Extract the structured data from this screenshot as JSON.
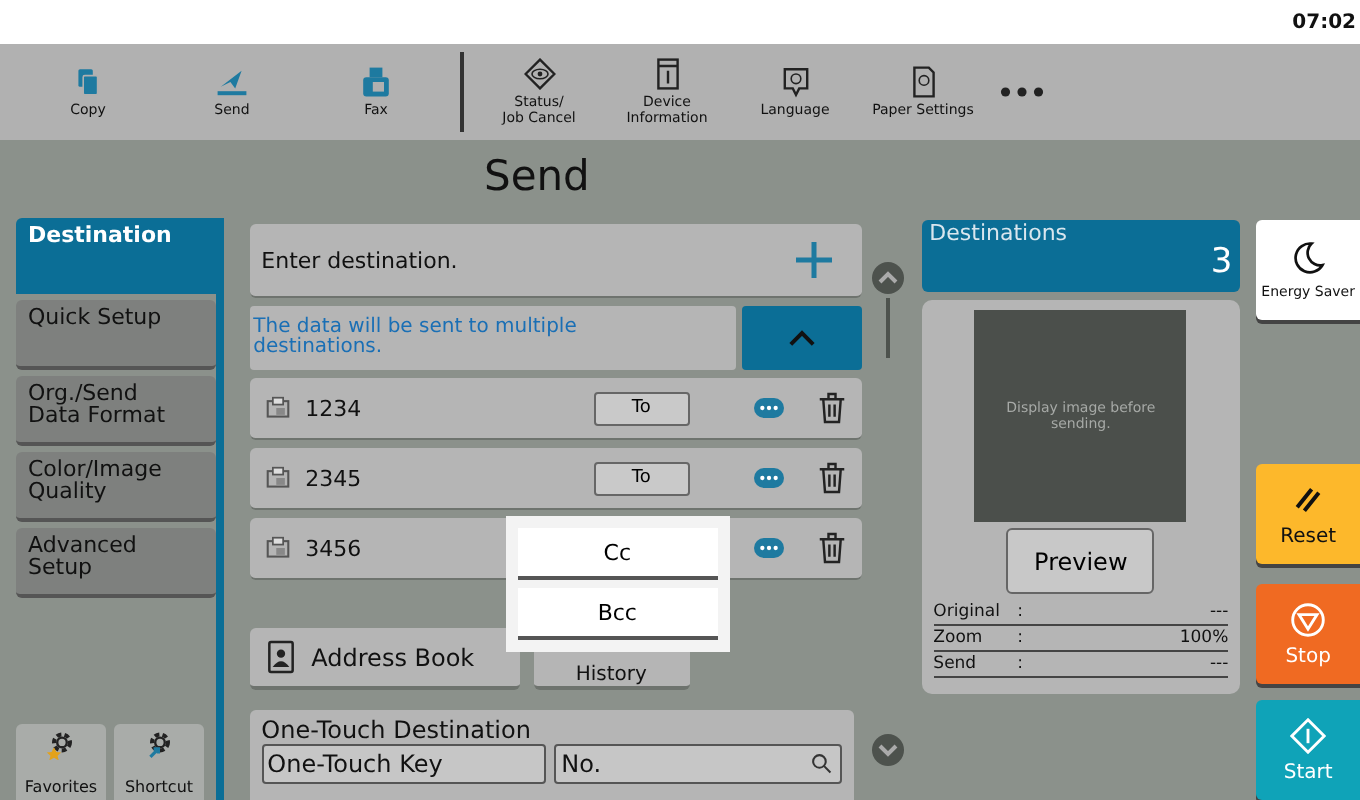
{
  "clock": "07:02",
  "toolbar": [
    {
      "label": "Copy",
      "kind": "copy"
    },
    {
      "label": "Send",
      "kind": "send"
    },
    {
      "label": "Fax",
      "kind": "fax"
    },
    {
      "label": "Status/\nJob Cancel",
      "kind": "status"
    },
    {
      "label": "Device\nInformation",
      "kind": "device"
    },
    {
      "label": "Language",
      "kind": "language"
    },
    {
      "label": "Paper Settings",
      "kind": "paper"
    }
  ],
  "title": "Send",
  "sidebar": [
    {
      "label": "Destination",
      "selected": true
    },
    {
      "label": "Quick Setup",
      "selected": false
    },
    {
      "label": "Org./Send\nData Format",
      "selected": false
    },
    {
      "label": "Color/Image\nQuality",
      "selected": false
    },
    {
      "label": "Advanced\nSetup",
      "selected": false
    }
  ],
  "bottom_buttons": [
    {
      "label": "Favorites",
      "kind": "favorites"
    },
    {
      "label": "Shortcut",
      "kind": "shortcut"
    }
  ],
  "destination_entry": {
    "label": "Enter destination."
  },
  "notice": {
    "text": "The data will be sent to multiple destinations.",
    "expanded": true
  },
  "destinations": [
    {
      "number": "1234",
      "type": "To"
    },
    {
      "number": "2345",
      "type": "To"
    },
    {
      "number": "3456"
    }
  ],
  "popup": {
    "options": [
      "Cc",
      "Bcc"
    ]
  },
  "source_tabs": [
    {
      "label": "Address Book",
      "kind": "address"
    },
    {
      "label": "History",
      "kind": "plain"
    }
  ],
  "one_touch": {
    "title": "One-Touch Destination",
    "key_label": "One-Touch Key",
    "search_placeholder": "No."
  },
  "destinations_count": {
    "label": "Destinations",
    "value": "3"
  },
  "preview": {
    "hint": "Display image before sending.",
    "button": "Preview"
  },
  "info": [
    {
      "label": "Original",
      "separator": ":",
      "value": "---"
    },
    {
      "label": "Zoom",
      "separator": ":",
      "value": "100%"
    },
    {
      "label": "Send",
      "separator": ":",
      "value": "---"
    }
  ],
  "side_keys": [
    {
      "label": "Energy Saver",
      "kind": "energy"
    },
    {
      "label": "Reset",
      "kind": "reset"
    },
    {
      "label": "Stop",
      "kind": "stop"
    },
    {
      "label": "Start",
      "kind": "start"
    }
  ]
}
